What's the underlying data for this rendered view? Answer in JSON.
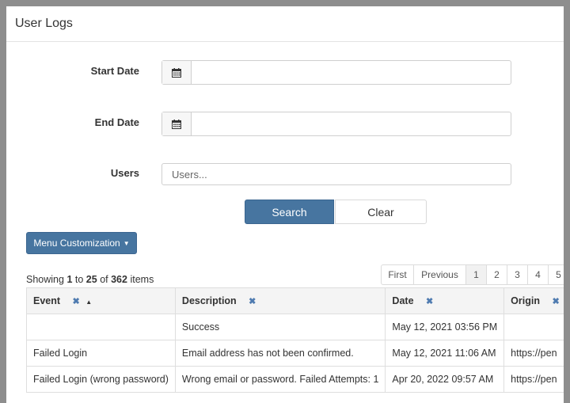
{
  "panel": {
    "title": "User Logs"
  },
  "filters": {
    "start_date_label": "Start Date",
    "end_date_label": "End Date",
    "users_label": "Users",
    "users_placeholder": "Users..."
  },
  "actions": {
    "search_label": "Search",
    "clear_label": "Clear",
    "menu_label": "Menu Customization"
  },
  "summary": {
    "prefix": "Showing",
    "from": "1",
    "to_word": "to",
    "to": "25",
    "of_word": "of",
    "total": "362",
    "suffix": "items"
  },
  "pagination": {
    "first": "First",
    "previous": "Previous",
    "pages": [
      "1",
      "2",
      "3",
      "4",
      "5"
    ],
    "active": "1"
  },
  "table": {
    "columns": [
      "Event",
      "Description",
      "Date",
      "Origin"
    ],
    "sorted_column": "Event",
    "rows": [
      {
        "event": "",
        "description": "Success",
        "date": "May 12, 2021 03:56 PM",
        "origin": ""
      },
      {
        "event": "Failed Login",
        "description": "Email address has not been confirmed.",
        "date": "May 12, 2021 11:06 AM",
        "origin": "https://pen"
      },
      {
        "event": "Failed Login (wrong password)",
        "description": "Wrong email or password. Failed Attempts: 1",
        "date": "Apr 20, 2022 09:57 AM",
        "origin": "https://pen"
      }
    ]
  },
  "colors": {
    "primary": "#4775a0",
    "remove_icon": "#4f7bb0"
  },
  "icons": {
    "calendar": "calendar-icon",
    "remove": "remove-filter-icon",
    "sort": "sort-asc-icon",
    "caret": "caret-down-icon"
  }
}
